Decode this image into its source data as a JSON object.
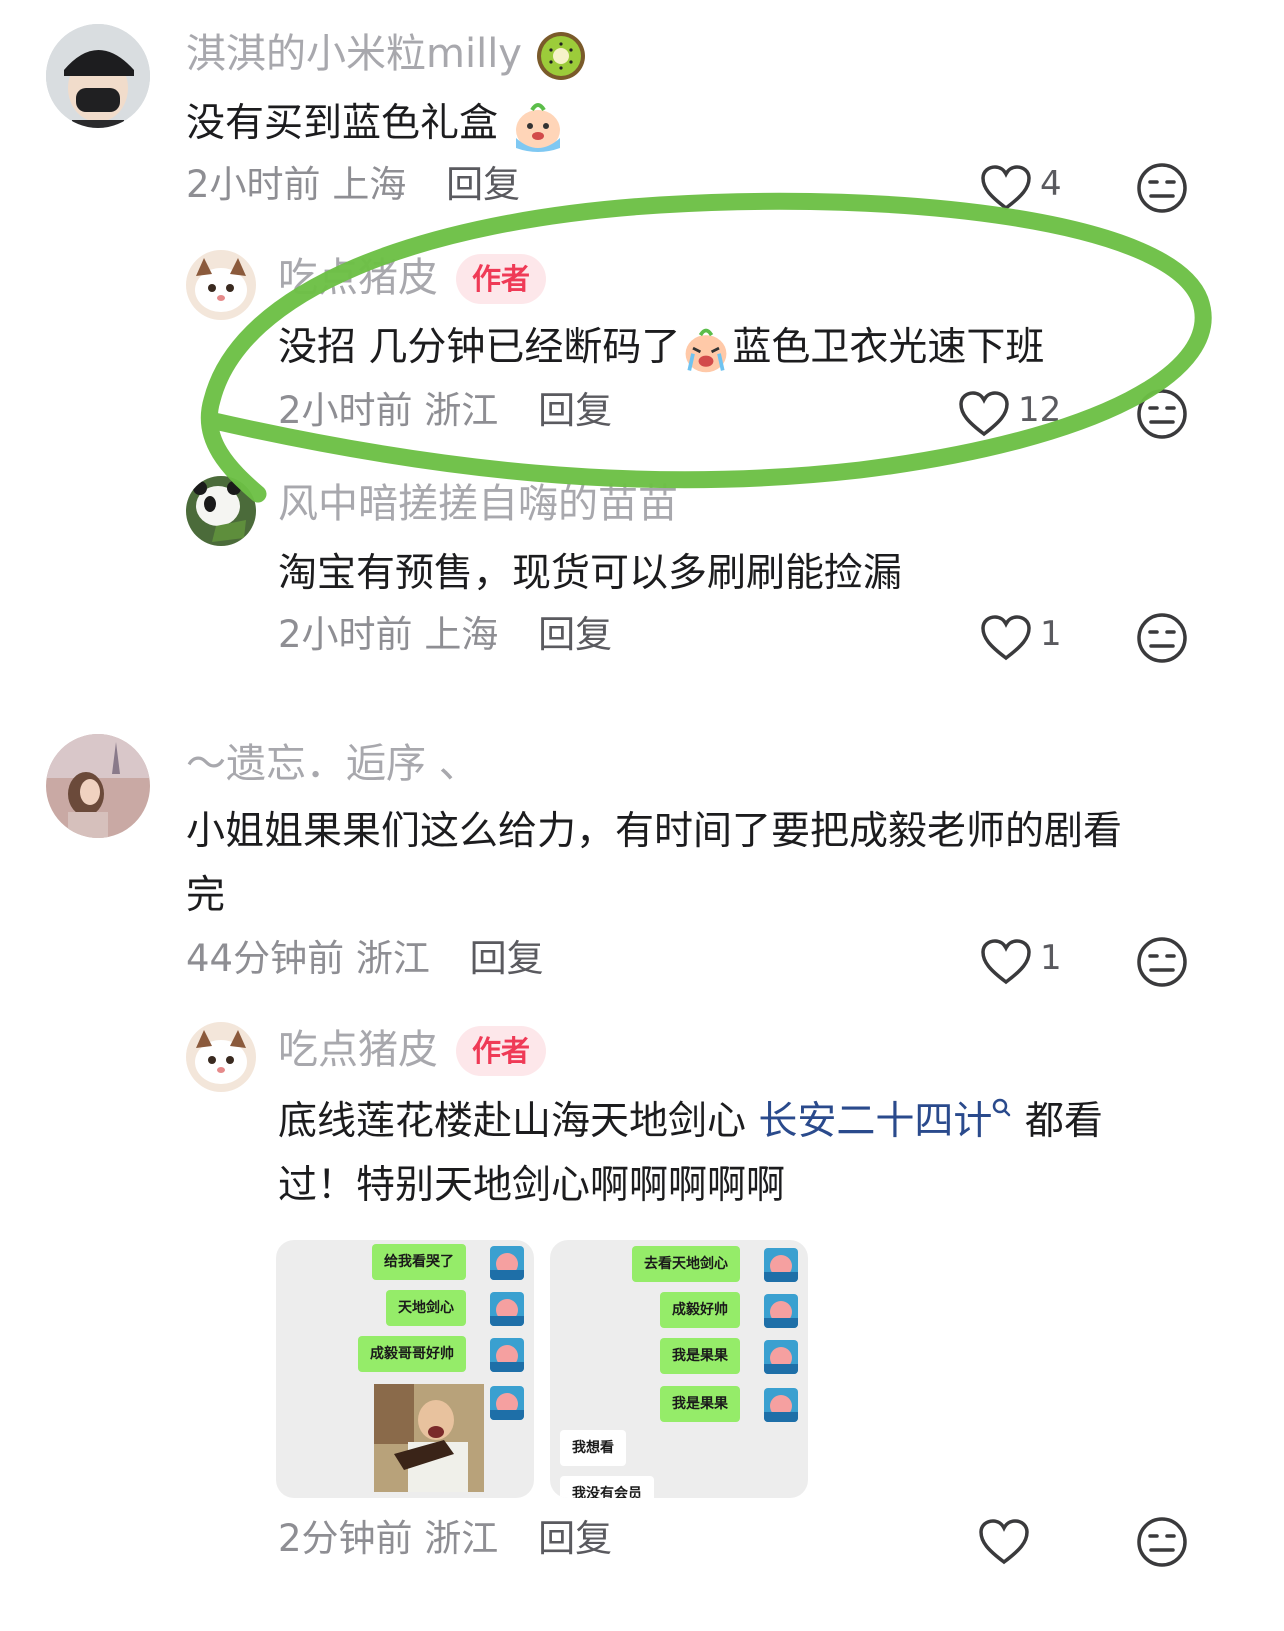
{
  "comments": [
    {
      "user": "淇淇的小米粒milly",
      "text": "没有买到蓝色礼盒",
      "time": "2小时前",
      "location": "上海",
      "reply_label": "回复",
      "likes": "4",
      "replies": [
        {
          "user": "吃点猪皮",
          "badge": "作者",
          "text_before": "没招 几分钟已经断码了",
          "text_after": "蓝色卫衣光速下班",
          "time": "2小时前",
          "location": "浙江",
          "reply_label": "回复",
          "likes": "12"
        },
        {
          "user": "风中暗搓搓自嗨的苗苗",
          "text": "淘宝有预售，现货可以多刷刷能捡漏",
          "time": "2小时前",
          "location": "上海",
          "reply_label": "回复",
          "likes": "1"
        }
      ]
    },
    {
      "user": "～遗忘．逅序 、",
      "text_line1": "小姐姐果果们这么给力，有时间了要把成毅老师的剧看",
      "text_line2": "完",
      "time": "44分钟前",
      "location": "浙江",
      "reply_label": "回复",
      "likes": "1",
      "replies": [
        {
          "user": "吃点猪皮",
          "badge": "作者",
          "text_before": "底线莲花楼赴山海天地剑心",
          "link": "长安二十四计",
          "text_after": "都看",
          "text_line2": "过！特别天地剑心啊啊啊啊啊",
          "time": "2分钟前",
          "location": "浙江",
          "reply_label": "回复",
          "images": [
            {
              "bubbles": [
                "给我看哭了",
                "天地剑心",
                "成毅哥哥好帅"
              ]
            },
            {
              "bubbles": [
                "去看天地剑心",
                "成毅好帅",
                "我是果果",
                "我是果果"
              ],
              "left_bubbles": [
                "我想看",
                "我没有会员"
              ]
            }
          ]
        }
      ]
    }
  ],
  "icons": [
    "heart-outline-icon",
    "neutral-face-icon",
    "kiwi-emoji",
    "crying-emoji",
    "search-small-icon"
  ],
  "colors": {
    "highlight_stroke": "#6cbf45",
    "badge_bg": "#fde7ea",
    "badge_text": "#ef3a56",
    "link": "#2a4a8c",
    "chat_green": "#95ec69"
  }
}
